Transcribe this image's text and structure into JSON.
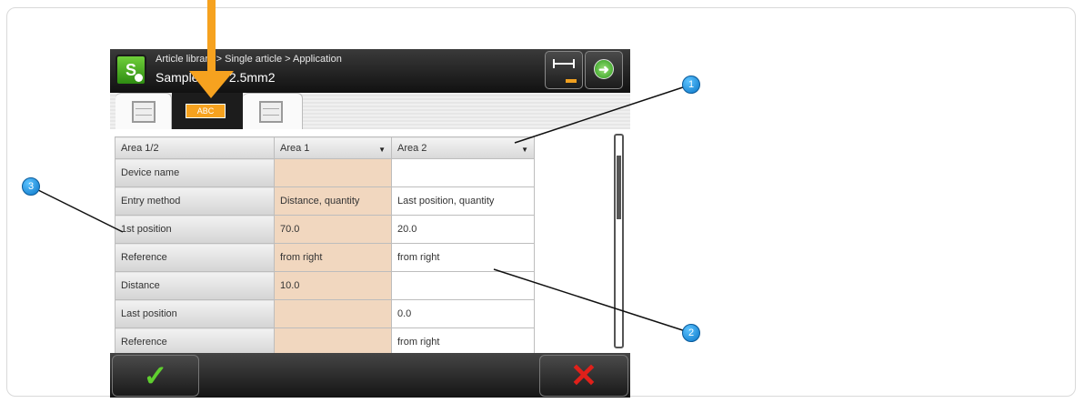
{
  "header": {
    "breadcrumb": "Article library > Single article > Application",
    "title": "Sample wire 2.5mm2"
  },
  "tabs": {
    "middle_badge": "ABC"
  },
  "table": {
    "headers": [
      "Area 1/2",
      "Area 1",
      "Area 2"
    ],
    "rows": [
      {
        "label": "Device name",
        "area1": "",
        "area2": ""
      },
      {
        "label": "Entry method",
        "area1": "Distance, quantity",
        "area2": "Last position, quantity"
      },
      {
        "label": "1st position",
        "area1": "70.0",
        "area2": "20.0"
      },
      {
        "label": "Reference",
        "area1": "from right",
        "area2": "from right"
      },
      {
        "label": "Distance",
        "area1": "10.0",
        "area2": ""
      },
      {
        "label": "Last position",
        "area1": "",
        "area2": "0.0"
      },
      {
        "label": "Reference",
        "area1": "",
        "area2": "from right"
      }
    ]
  },
  "callouts": [
    "1",
    "2",
    "3"
  ],
  "icons": {
    "app": "app-logo-icon",
    "width": "width-measure-icon",
    "next": "next-arrow-icon",
    "ok": "checkmark-icon",
    "cancel": "cross-icon"
  },
  "colors": {
    "accent_orange": "#f6a21f",
    "peach_cell": "#f1d7bf",
    "ok_green": "#5fcf2f",
    "cancel_red": "#e0201a",
    "callout_blue": "#0b77c8"
  }
}
